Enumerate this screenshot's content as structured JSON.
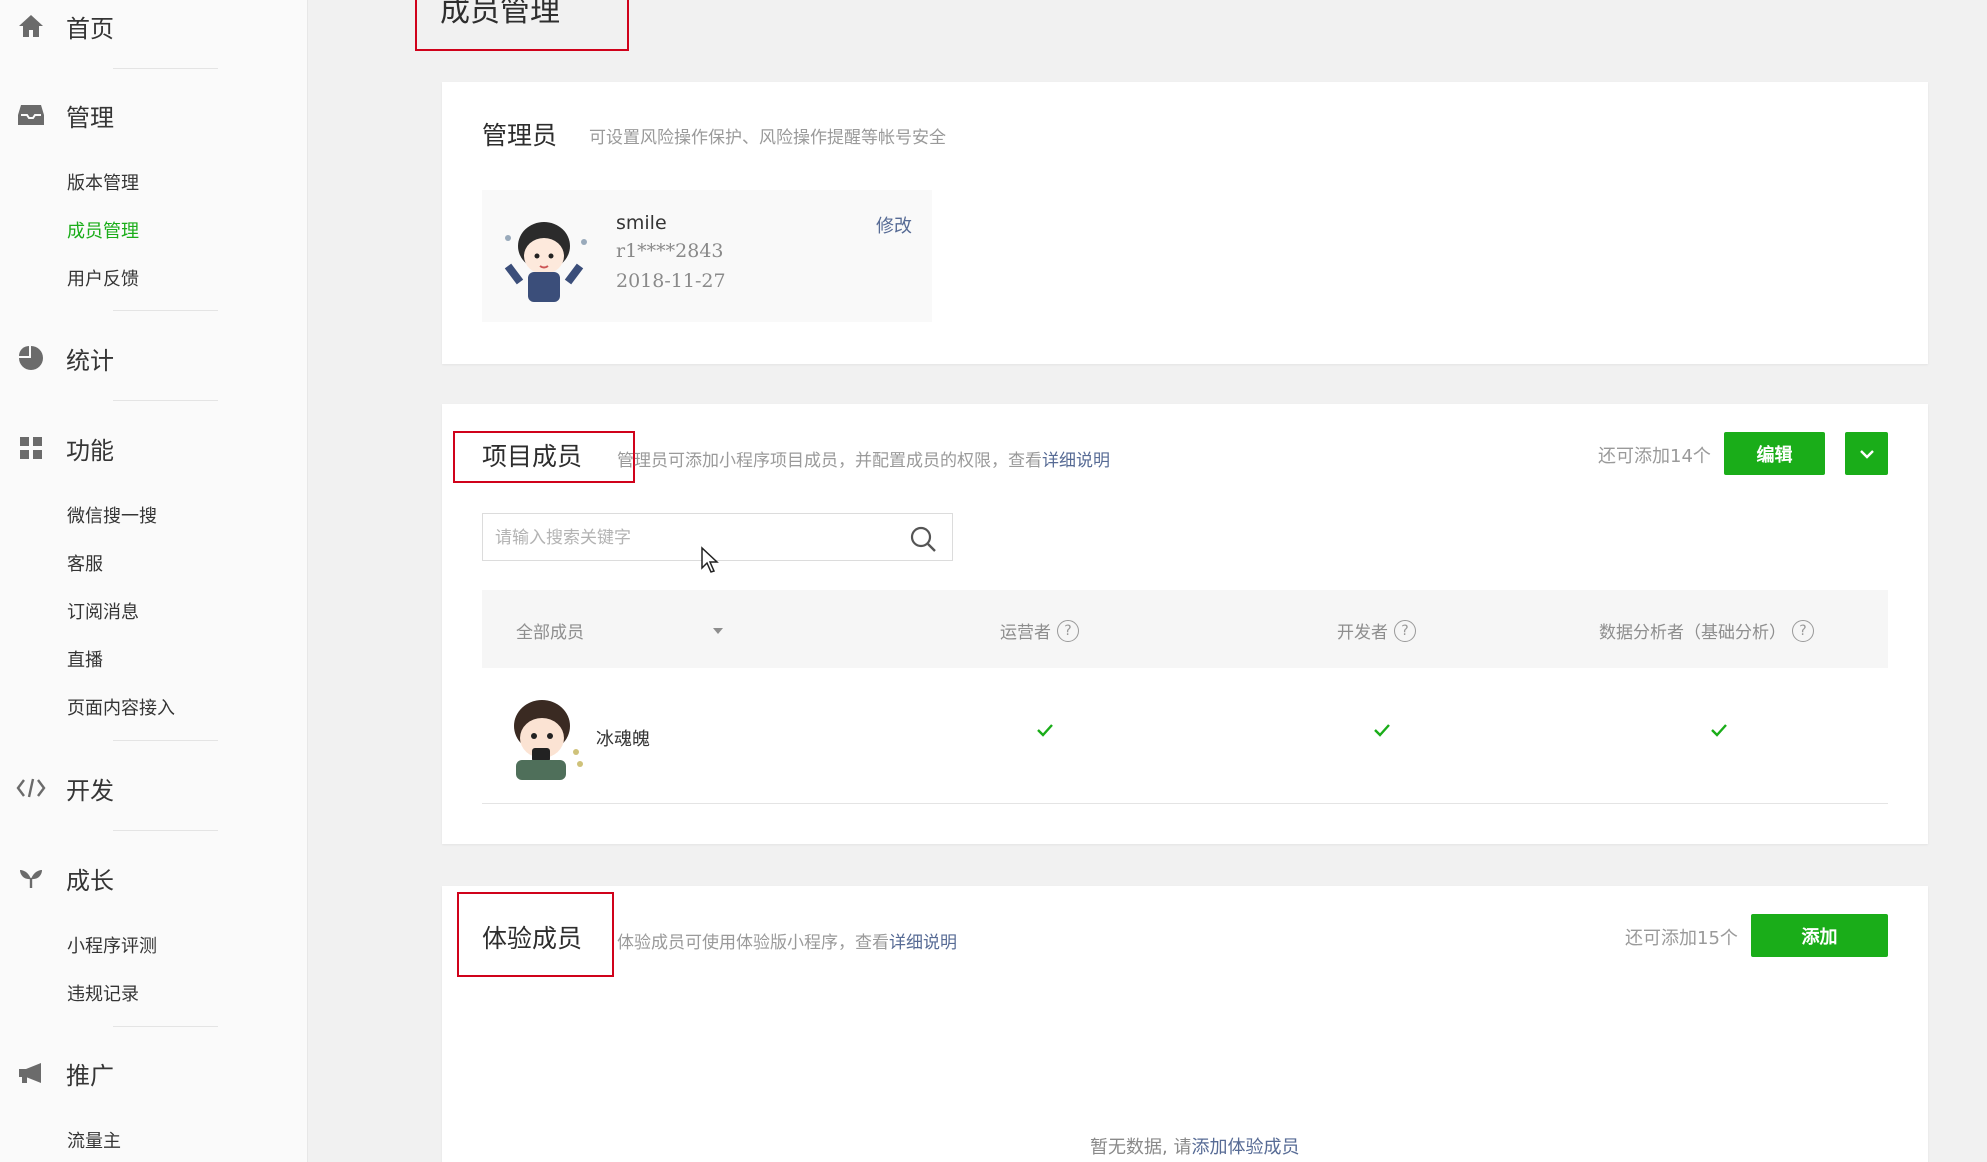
{
  "sidebar": {
    "home": {
      "label": "首页",
      "icon": "home-icon"
    },
    "manage": {
      "label": "管理",
      "icon": "inbox-icon",
      "items": [
        "版本管理",
        "成员管理",
        "用户反馈"
      ],
      "active": "成员管理"
    },
    "stats": {
      "label": "统计",
      "icon": "pie-chart-icon"
    },
    "features": {
      "label": "功能",
      "icon": "grid-icon",
      "items": [
        "微信搜一搜",
        "客服",
        "订阅消息",
        "直播",
        "页面内容接入"
      ]
    },
    "dev": {
      "label": "开发",
      "icon": "code-icon"
    },
    "growth": {
      "label": "成长",
      "icon": "sprout-icon",
      "items": [
        "小程序评测",
        "违规记录"
      ]
    },
    "promo": {
      "label": "推广",
      "icon": "megaphone-icon",
      "items": [
        "流量主"
      ]
    }
  },
  "page": {
    "title": "成员管理"
  },
  "admin": {
    "title": "管理员",
    "desc": "可设置风险操作保护、风险操作提醒等帐号安全",
    "name": "smile",
    "id": "r1****2843",
    "date": "2018-11-27",
    "edit_label": "修改"
  },
  "project": {
    "title": "项目成员",
    "desc": "管理员可添加小程序项目成员，并配置成员的权限，查看",
    "desc_link": "详细说明",
    "quota": "还可添加14个",
    "edit_btn": "编辑",
    "search_placeholder": "请输入搜索关键字",
    "columns": {
      "filter": "全部成员",
      "operator": "运营者",
      "developer": "开发者",
      "analyst": "数据分析者（基础分析）"
    },
    "members": [
      {
        "name": "冰魂魄",
        "operator": true,
        "developer": true,
        "analyst": true
      }
    ]
  },
  "trial": {
    "title": "体验成员",
    "desc": "体验成员可使用体验版小程序，查看",
    "desc_link": "详细说明",
    "quota": "还可添加15个",
    "add_btn": "添加",
    "empty": "暂无数据, 请",
    "empty_link": "添加体验成员"
  },
  "colors": {
    "accent": "#1aad19",
    "link": "#576b95",
    "highlight": "#d0021b"
  }
}
